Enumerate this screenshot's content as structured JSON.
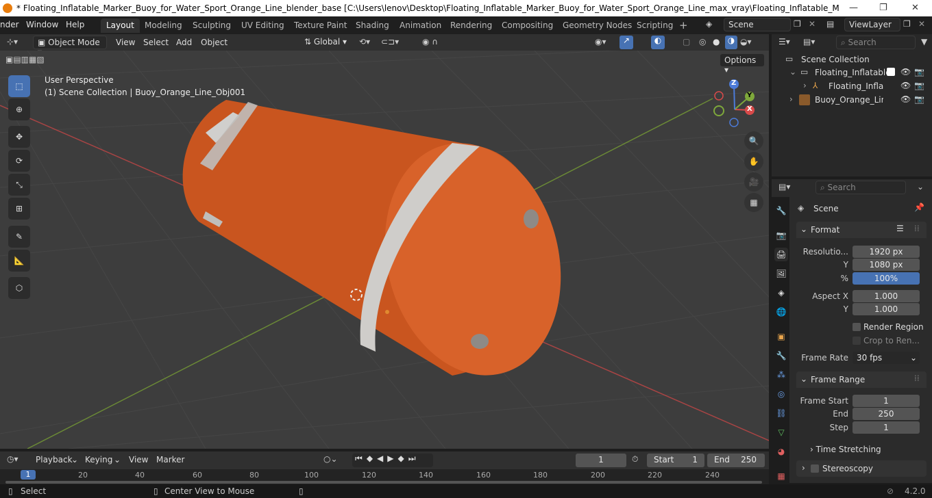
{
  "window": {
    "title": "* Floating_Inflatable_Marker_Buoy_for_Water_Sport_Orange_Line_blender_base [C:\\Users\\lenov\\Desktop\\Floating_Inflatable_Marker_Buoy_for_Water_Sport_Orange_Line_max_vray\\Floating_Inflatable_Marker_Buoy_for_Water_Sp...",
    "minimize": "—",
    "maximize": "❐",
    "close": "✕"
  },
  "menu": [
    "nder",
    "Window",
    "Help"
  ],
  "workspaces": [
    "Layout",
    "Modeling",
    "Sculpting",
    "UV Editing",
    "Texture Paint",
    "Shading",
    "Animation",
    "Rendering",
    "Compositing",
    "Geometry Nodes",
    "Scripting"
  ],
  "scene_field": "Scene",
  "viewlayer_field": "ViewLayer",
  "viewport_header": {
    "mode": "Object Mode",
    "menus": [
      "View",
      "Select",
      "Add",
      "Object"
    ],
    "orientation": "Global",
    "options": "Options"
  },
  "viewport": {
    "perspective": "User Perspective",
    "collection_info": "(1) Scene Collection | Buoy_Orange_Line_Obj001",
    "gizmo": {
      "x": "X",
      "y": "Y",
      "z": "Z"
    }
  },
  "outliner": {
    "search_placeholder": "Search",
    "rows": [
      {
        "label": "Scene Collection"
      },
      {
        "label": "Floating_Inflatable"
      },
      {
        "label": "Floating_Inflat"
      },
      {
        "label": "Buoy_Orange_Line_"
      }
    ]
  },
  "properties": {
    "search_placeholder": "Search",
    "scene_label": "Scene",
    "format": {
      "title": "Format",
      "resolution_label": "Resolutio...",
      "res_x": "1920 px",
      "y_label": "Y",
      "res_y": "1080 px",
      "pct_label": "%",
      "pct": "100%",
      "aspect_x_label": "Aspect X",
      "aspect_x": "1.000",
      "aspect_y_label": "Y",
      "aspect_y": "1.000",
      "render_region": "Render Region",
      "crop": "Crop to Ren...",
      "frame_rate_label": "Frame Rate",
      "frame_rate": "30 fps"
    },
    "frame_range": {
      "title": "Frame Range",
      "start_label": "Frame Start",
      "start": "1",
      "end_label": "End",
      "end": "250",
      "step_label": "Step",
      "step": "1"
    },
    "time_stretching": "Time Stretching",
    "stereoscopy": "Stereoscopy"
  },
  "timeline": {
    "menus": [
      "Playback",
      "Keying",
      "View",
      "Marker"
    ],
    "current_frame": "1",
    "start_label": "Start",
    "start": "1",
    "end_label": "End",
    "end": "250",
    "ticks": [
      "1",
      "20",
      "40",
      "60",
      "80",
      "100",
      "120",
      "140",
      "160",
      "180",
      "200",
      "220",
      "240"
    ]
  },
  "statusbar": {
    "select": "Select",
    "center_view": "Center View to Mouse",
    "version": "4.2.0"
  },
  "colors": {
    "accent": "#4772b3",
    "buoy": "#d9622b",
    "x_axis": "#d94a4a",
    "y_axis": "#7ea83b",
    "z_axis": "#4c7bd9"
  }
}
